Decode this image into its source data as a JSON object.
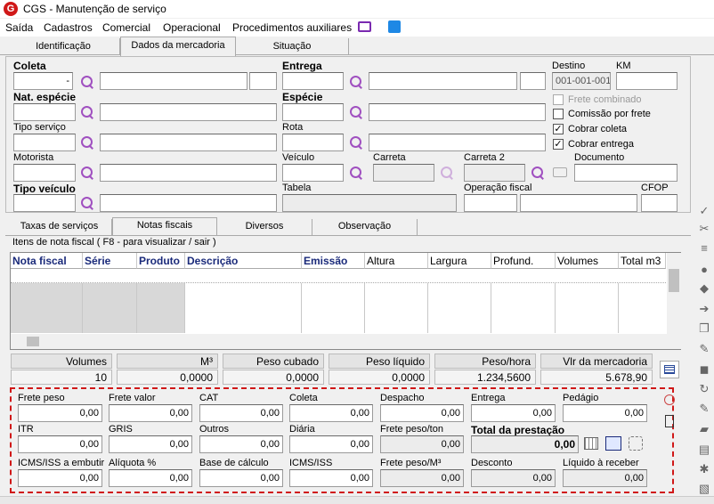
{
  "window": {
    "title": "CGS - Manutenção de serviço",
    "logo": "G"
  },
  "menu": [
    "Saída",
    "Cadastros",
    "Comercial",
    "Operacional",
    "Procedimentos auxiliares"
  ],
  "tabs_top": [
    "Identificação",
    "Dados da mercadoria",
    "Situação"
  ],
  "form": {
    "coleta_label": "Coleta",
    "coleta_value": "-",
    "entrega_label": "Entrega",
    "destino_label": "Destino",
    "destino_value": "001-001-001",
    "km_label": "KM",
    "nat_especie_label": "Nat. espécie",
    "especie_label": "Espécie",
    "tipo_servico_label": "Tipo serviço",
    "rota_label": "Rota",
    "motorista_label": "Motorista",
    "veiculo_label": "Veículo",
    "carreta_label": "Carreta",
    "carreta2_label": "Carreta 2",
    "documento_label": "Documento",
    "tipo_veiculo_label": "Tipo veículo",
    "tabela_label": "Tabela",
    "operacao_fiscal_label": "Operação fiscal",
    "cfop_label": "CFOP",
    "frete_combinado": "Frete combinado",
    "comissao_por_frete": "Comissão por frete",
    "cobrar_coleta": "Cobrar coleta",
    "cobrar_entrega": "Cobrar entrega",
    "check_mark": "✓"
  },
  "tabs_mid": [
    "Taxas de serviços",
    "Notas fiscais",
    "Diversos",
    "Observação"
  ],
  "nf_group_label": "Itens de nota fiscal ( F8 - para visualizar / sair )",
  "grid": {
    "headers": [
      "Nota fiscal",
      "Série",
      "Produto",
      "Descrição",
      "Emissão",
      "Altura",
      "Largura",
      "Profund.",
      "Volumes",
      "Total m3"
    ]
  },
  "summary": {
    "headers": [
      "Volumes",
      "M³",
      "Peso cubado",
      "Peso líquido",
      "Peso/hora",
      "Vlr da mercadoria"
    ],
    "values": [
      "10",
      "0,0000",
      "0,0000",
      "0,0000",
      "1.234,5600",
      "5.678,90"
    ]
  },
  "values": {
    "frete_peso": {
      "label": "Frete peso",
      "value": "0,00"
    },
    "frete_valor": {
      "label": "Frete valor",
      "value": "0,00"
    },
    "cat": {
      "label": "CAT",
      "value": "0,00"
    },
    "coleta": {
      "label": "Coleta",
      "value": "0,00"
    },
    "despacho": {
      "label": "Despacho",
      "value": "0,00"
    },
    "entrega": {
      "label": "Entrega",
      "value": "0,00"
    },
    "pedagio": {
      "label": "Pedágio",
      "value": "0,00"
    },
    "itr": {
      "label": "ITR",
      "value": "0,00"
    },
    "gris": {
      "label": "GRIS",
      "value": "0,00"
    },
    "outros": {
      "label": "Outros",
      "value": "0,00"
    },
    "diaria": {
      "label": "Diária",
      "value": "0,00"
    },
    "frete_peso_ton": {
      "label": "Frete peso/ton",
      "value": "0,00"
    },
    "total_prestacao": {
      "label": "Total da prestação",
      "value": "0,00"
    },
    "icms_iss_embutir": {
      "label": "ICMS/ISS a embutir",
      "value": "0,00"
    },
    "aliquota": {
      "label": "Alíquota %",
      "value": "0,00"
    },
    "base_calculo": {
      "label": "Base de cálculo",
      "value": "0,00"
    },
    "icms_iss": {
      "label": "ICMS/ISS",
      "value": "0,00"
    },
    "frete_peso_m3": {
      "label": "Frete peso/M³",
      "value": "0,00"
    },
    "desconto": {
      "label": "Desconto",
      "value": "0,00"
    },
    "liquido_receber": {
      "label": "Líquido à receber",
      "value": "0,00"
    }
  }
}
